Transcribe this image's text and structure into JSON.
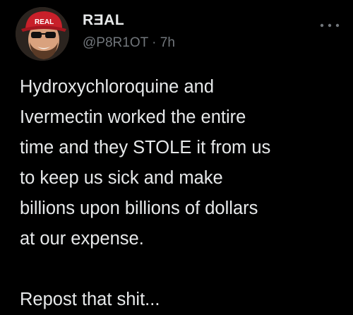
{
  "tweet": {
    "avatar": {
      "icon": "profile-avatar-red-cap-sunglasses",
      "cap_text": "REAL",
      "cap_color": "#c8202a"
    },
    "display_name": "RƎAL",
    "handle": "@P8R1OT",
    "separator": "·",
    "time": "7h",
    "more_icon": "ellipsis-icon",
    "body_lines": [
      "Hydroxychloroquine and",
      "Ivermectin worked the entire",
      "time and they STOLE it from us",
      "to keep us sick and make",
      "billions upon billions of dollars",
      "at our expense."
    ],
    "closing_line": "Repost that shit..."
  },
  "colors": {
    "background": "#000000",
    "primary_text": "#e7e9ea",
    "secondary_text": "#71767b"
  }
}
